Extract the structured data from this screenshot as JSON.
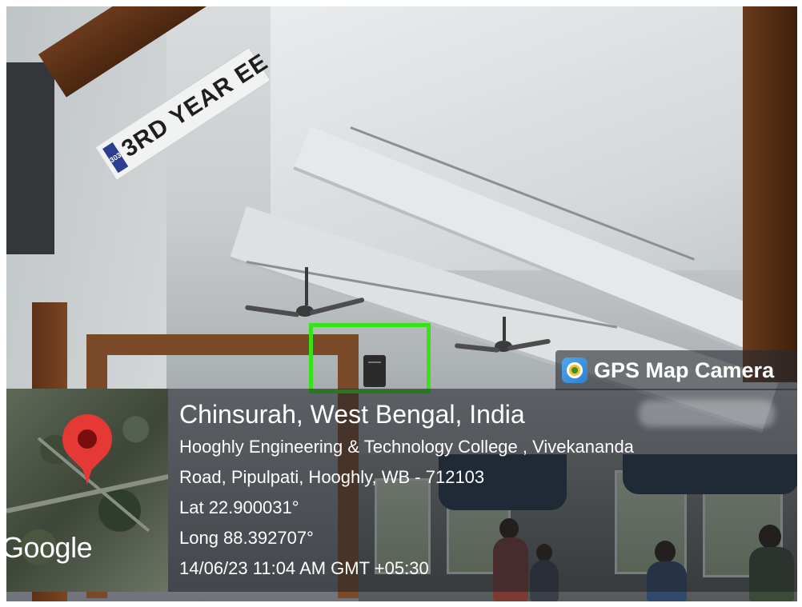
{
  "scene": {
    "sign_room": "303",
    "sign_text": "3RD YEAR EE"
  },
  "gps_badge": {
    "icon": "gps-map-camera-icon",
    "title": "GPS Map Camera"
  },
  "map": {
    "pin_icon": "map-pin-icon",
    "brand": "Google"
  },
  "location": {
    "title": "Chinsurah, West Bengal, India",
    "address_line1": "Hooghly Engineering & Technology College , Vivekananda",
    "address_line2": "Road, Pipulpati, Hooghly, WB - 712103",
    "lat": "Lat 22.900031°",
    "long": "Long 88.392707°",
    "timestamp": "14/06/23 11:04 AM GMT +05:30"
  },
  "highlight": {
    "color": "#35e318"
  }
}
